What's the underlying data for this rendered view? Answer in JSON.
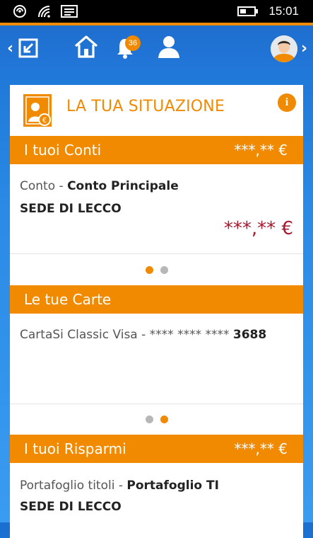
{
  "status_bar": {
    "time": "15:01"
  },
  "nav": {
    "notification_count": "36"
  },
  "header": {
    "title": "LA TUA SITUAZIONE"
  },
  "conti": {
    "title": "I tuoi Conti",
    "amount": "***,** €",
    "account_label": "Conto - ",
    "account_name": "Conto Principale",
    "branch": "SEDE DI LECCO",
    "balance": "***,** €"
  },
  "carte": {
    "title": "Le tue Carte",
    "card_label": "CartaSi Classic Visa - **** **** **** ",
    "card_last": "3688"
  },
  "risparmi": {
    "title": "I tuoi Risparmi",
    "amount": "***,** €",
    "portfolio_label": "Portafoglio titoli - ",
    "portfolio_name": "Portafoglio TI",
    "branch": "SEDE DI LECCO"
  },
  "colors": {
    "accent": "#f08a00",
    "nav_blue": "#1e6ecf",
    "amount_red": "#a6192e"
  }
}
